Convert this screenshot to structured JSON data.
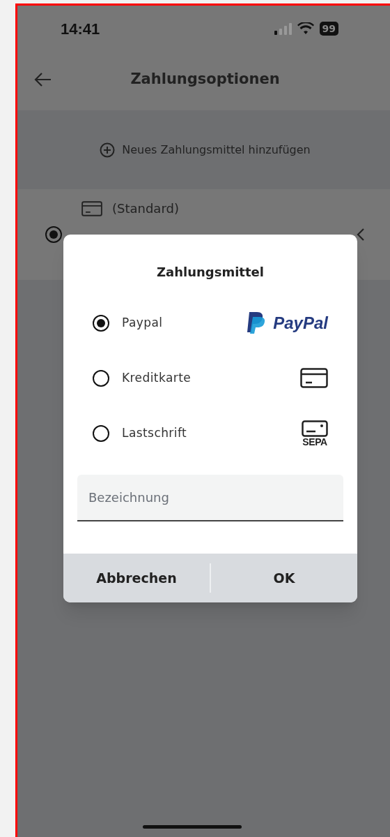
{
  "status_bar": {
    "time": "14:41",
    "battery": "99"
  },
  "header": {
    "title": "Zahlungsoptionen"
  },
  "add_button": {
    "label": "Neues Zahlungsmittel hinzufügen"
  },
  "saved_methods": [
    {
      "label": "(Standard)",
      "selected": true
    }
  ],
  "dialog": {
    "title": "Zahlungsmittel",
    "options": [
      {
        "label": "Paypal",
        "kind": "paypal",
        "logo_text": "PayPal",
        "selected": true
      },
      {
        "label": "Kreditkarte",
        "kind": "card",
        "selected": false
      },
      {
        "label": "Lastschrift",
        "kind": "sepa",
        "logo_text": "SEPA",
        "selected": false
      }
    ],
    "field": {
      "placeholder": "Bezeichnung"
    },
    "buttons": [
      "Abbrechen",
      "OK"
    ]
  }
}
